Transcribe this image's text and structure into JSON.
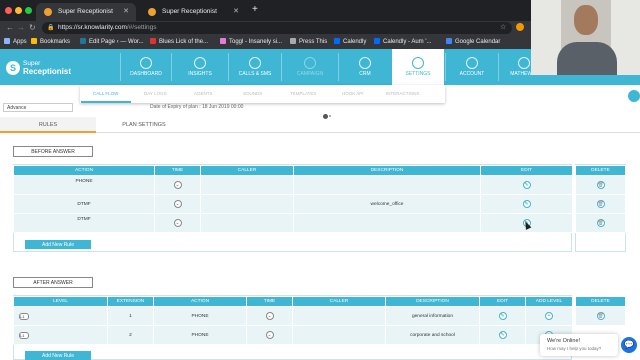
{
  "browser": {
    "tabs": [
      {
        "title": "Super Receptionist",
        "active": true
      },
      {
        "title": "Super Receptionist",
        "active": false
      }
    ],
    "new_tab": "+",
    "url_host": "https://sr.knowlarity.com",
    "url_path": "/#/settings",
    "bookmarks": [
      {
        "label": "Apps",
        "icon": "apps-grid-icon"
      },
      {
        "label": "Bookmarks",
        "icon": "star-icon"
      },
      {
        "label": "Edit Page ‹ — Wor...",
        "icon": "wordpress-icon"
      },
      {
        "label": "Blues Lick of the...",
        "icon": "music-icon"
      },
      {
        "label": "Toggl - Insanely si...",
        "icon": "toggl-icon"
      },
      {
        "label": "Press This",
        "icon": "press-icon"
      },
      {
        "label": "Calendly",
        "icon": "calendly-icon"
      },
      {
        "label": "Calendly - Aum '...",
        "icon": "calendly-icon"
      },
      {
        "label": "Google Calendar",
        "icon": "calendar-icon"
      }
    ]
  },
  "app": {
    "logo_line1": "Super",
    "logo_line2": "Receptionist",
    "nav": [
      {
        "label": "DASHBOARD",
        "state": "normal"
      },
      {
        "label": "INSIGHTS",
        "state": "normal"
      },
      {
        "label": "CALLS & SMS",
        "state": "normal"
      },
      {
        "label": "CAMPAIGN",
        "state": "muted"
      },
      {
        "label": "CRM",
        "state": "normal"
      },
      {
        "label": "SETTINGS",
        "state": "selected"
      },
      {
        "label": "ACCOUNT",
        "state": "normal"
      },
      {
        "label": "MATHEW",
        "state": "normal"
      }
    ],
    "subnav": [
      {
        "label": "CALL FLOW",
        "active": true
      },
      {
        "label": "DAY LOGS",
        "active": false
      },
      {
        "label": "AGENTS",
        "active": false
      },
      {
        "label": "SOUNDS",
        "active": false
      },
      {
        "label": "TEMPLATES",
        "active": false
      },
      {
        "label": "HOOK API",
        "active": false
      },
      {
        "label": "INTERACTIONS",
        "active": false
      }
    ],
    "mode_select": "Advance",
    "expiry_text": "Date of Expiry of plan : 18 Jun 2019 00:00",
    "page_tabs": [
      {
        "label": "RULES",
        "active": true
      },
      {
        "label": "PLAN SETTINGS",
        "active": false
      }
    ],
    "before": {
      "title": "BEFORE ANSWER",
      "headers": [
        "ACTION",
        "TIME",
        "CALLER",
        "DESCRIPTION",
        "EDIT",
        "DELETE"
      ],
      "rows": [
        {
          "action": "PHONE",
          "caller": "",
          "description": ""
        },
        {
          "action": "DTMF",
          "caller": "",
          "description": "welcome_office"
        },
        {
          "action": "DTMF",
          "caller": "",
          "description": ""
        }
      ],
      "add_label": "Add New Rule"
    },
    "after": {
      "title": "AFTER ANSWER",
      "headers": [
        "LEVEL",
        "EXTENSION",
        "ACTION",
        "TIME",
        "CALLER",
        "DESCRIPTION",
        "EDIT",
        "ADD LEVEL",
        "DELETE"
      ],
      "rows": [
        {
          "level": "L1",
          "extension": "1",
          "action": "PHONE",
          "caller": "",
          "description": "general information"
        },
        {
          "level": "L1",
          "extension": "2",
          "action": "PHONE",
          "caller": "",
          "description": "corporate and school"
        }
      ],
      "add_label": "Add New Rule"
    },
    "chat": {
      "title": "We're Online!",
      "subtitle": "How may I help you today?"
    }
  },
  "colors": {
    "brand": "#3eb6d4",
    "accent": "#f0a030",
    "chrome_dark": "#202124"
  }
}
